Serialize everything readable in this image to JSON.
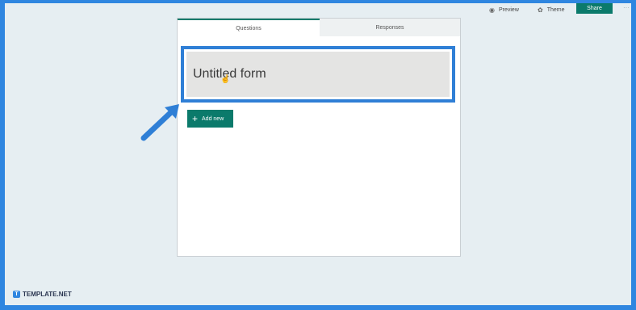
{
  "toolbar": {
    "preview_label": "Preview",
    "preview_icon": "eye-icon",
    "theme_label": "Theme",
    "theme_icon": "palette-icon",
    "share_label": "Share",
    "more_icon": "more-icon"
  },
  "tabs": [
    {
      "label": "Questions",
      "active": true
    },
    {
      "label": "Responses",
      "active": false
    }
  ],
  "form": {
    "title": "Untitled form",
    "add_new_label": "Add new"
  },
  "watermark": {
    "text": "TEMPLATE.NET"
  },
  "colors": {
    "accent": "#0b7a6b",
    "highlight": "#2f7fd6",
    "background": "#e6eef2"
  }
}
